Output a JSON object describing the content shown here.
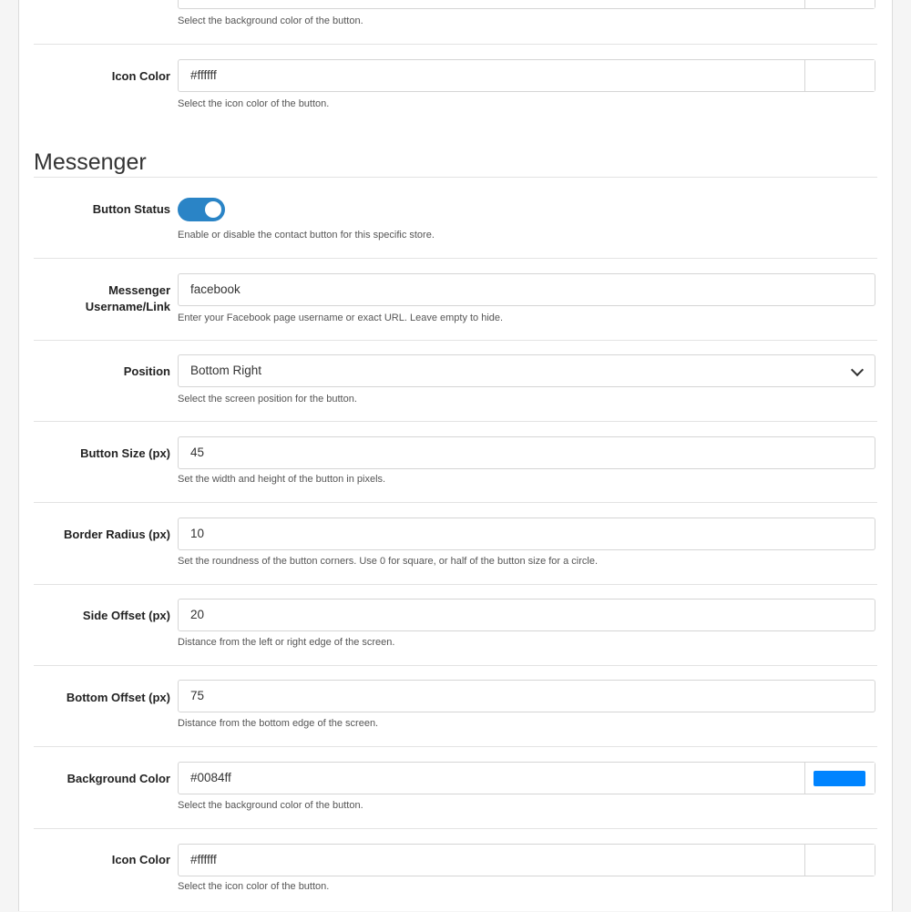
{
  "whatsapp_partial": {
    "background_help": "Select the background color of the button.",
    "background_swatch": "#25d366",
    "icon_color": {
      "label": "Icon Color",
      "value": "#ffffff",
      "help": "Select the icon color of the button.",
      "swatch": "#ffffff"
    }
  },
  "messenger": {
    "section_title": "Messenger",
    "button_status": {
      "label": "Button Status",
      "enabled": true,
      "help": "Enable or disable the contact button for this specific store."
    },
    "username": {
      "label_line1": "Messenger",
      "label_line2": "Username/Link",
      "value": "facebook",
      "help": "Enter your Facebook page username or exact URL. Leave empty to hide."
    },
    "position": {
      "label": "Position",
      "value": "Bottom Right",
      "help": "Select the screen position for the button."
    },
    "button_size": {
      "label": "Button Size (px)",
      "value": "45",
      "help": "Set the width and height of the button in pixels."
    },
    "border_radius": {
      "label": "Border Radius (px)",
      "value": "10",
      "help": "Set the roundness of the button corners. Use 0 for square, or half of the button size for a circle."
    },
    "side_offset": {
      "label": "Side Offset (px)",
      "value": "20",
      "help": "Distance from the left or right edge of the screen."
    },
    "bottom_offset": {
      "label": "Bottom Offset (px)",
      "value": "75",
      "help": "Distance from the bottom edge of the screen."
    },
    "background_color": {
      "label": "Background Color",
      "value": "#0084ff",
      "help": "Select the background color of the button.",
      "swatch": "#0084ff"
    },
    "icon_color": {
      "label": "Icon Color",
      "value": "#ffffff",
      "help": "Select the icon color of the button.",
      "swatch": "#ffffff"
    }
  }
}
